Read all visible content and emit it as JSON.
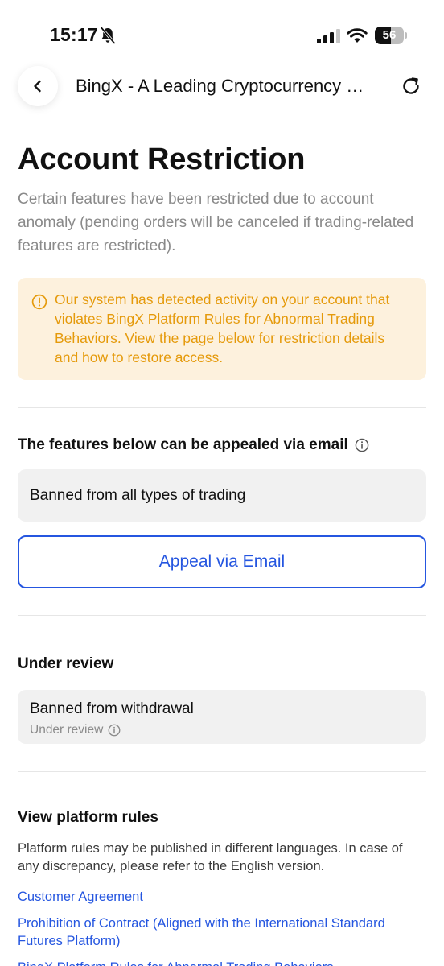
{
  "status_bar": {
    "time": "15:17",
    "battery_level": "56",
    "icons": [
      "bell-slash-icon",
      "cellular-signal-icon",
      "wifi-icon",
      "battery-icon"
    ]
  },
  "nav": {
    "title": "BingX - A Leading Cryptocurrency Exchange",
    "icons": [
      "chevron-left-icon",
      "refresh-icon"
    ]
  },
  "page": {
    "title": "Account Restriction",
    "description": "Certain features have been restricted due to account anomaly (pending orders will be canceled if trading-related features are restricted)."
  },
  "warning": {
    "text": "Our system has detected activity on your account that violates BingX Platform Rules for Abnormal Trading Behaviors. View the page below for restriction details and how to restore access.",
    "color": "#e59a0b",
    "background": "#fdf1dd"
  },
  "appealable": {
    "title": "The features below can be appealed via email",
    "items": [
      "Banned from all types of trading"
    ],
    "button_label": "Appeal via Email"
  },
  "under_review": {
    "title": "Under review",
    "item_title": "Banned from withdrawal",
    "item_status": "Under review"
  },
  "platform_rules": {
    "title": "View platform rules",
    "description": "Platform rules may be published in different languages. In case of any discrepancy, please refer to the English version.",
    "links": [
      "Customer Agreement",
      "Prohibition of Contract (Aligned with the International Standard Futures Platform)",
      "BingX Platform Rules for Abnormal Trading Behaviors"
    ]
  },
  "colors": {
    "accent": "#2556e0",
    "muted_text": "#8a8a8a",
    "box_background": "#f1f1f1"
  }
}
